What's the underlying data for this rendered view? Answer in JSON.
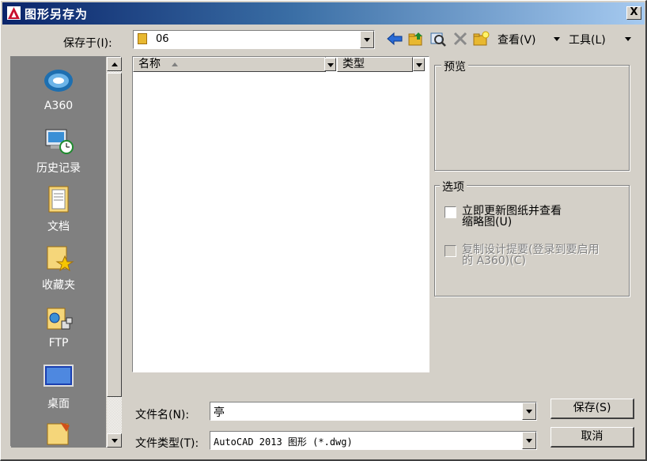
{
  "dialog": {
    "title": "图形另存为",
    "close_label": "X"
  },
  "save_in": {
    "label": "保存于(I):",
    "value": "06"
  },
  "toolbar": {
    "icons": [
      "back-arrow-icon",
      "up-folder-icon",
      "search-web-icon",
      "delete-icon",
      "new-folder-icon"
    ],
    "view_label": "查看(V)",
    "tools_label": "工具(L)"
  },
  "places": [
    {
      "label": "A360",
      "icon": "a360-icon"
    },
    {
      "label": "历史记录",
      "icon": "history-icon"
    },
    {
      "label": "文档",
      "icon": "documents-icon"
    },
    {
      "label": "收藏夹",
      "icon": "favorites-icon"
    },
    {
      "label": "FTP",
      "icon": "ftp-icon"
    },
    {
      "label": "桌面",
      "icon": "desktop-icon"
    }
  ],
  "file_list": {
    "columns": [
      {
        "label": "名称"
      },
      {
        "label": "类型"
      }
    ]
  },
  "preview": {
    "label": "预览"
  },
  "options": {
    "label": "选项",
    "items": [
      {
        "line1": "立即更新图纸并查看",
        "line2": "缩略图(U)",
        "checked": false,
        "enabled": true
      },
      {
        "line1": "复制设计提要(登录到要启用",
        "line2": "的 A360)(C)",
        "checked": false,
        "enabled": false
      }
    ]
  },
  "file_name": {
    "label": "文件名(N):",
    "value": "亭"
  },
  "file_type": {
    "label": "文件类型(T):",
    "value": "AutoCAD 2013 图形 (*.dwg)"
  },
  "buttons": {
    "save": "保存(S)",
    "cancel": "取消"
  },
  "colors": {
    "title_gradient_start": "#0a246a",
    "title_gradient_end": "#a6caf0",
    "dialog_bg": "#d4d0c8",
    "places_bg": "#808080",
    "autocad_red": "#c8102e"
  }
}
